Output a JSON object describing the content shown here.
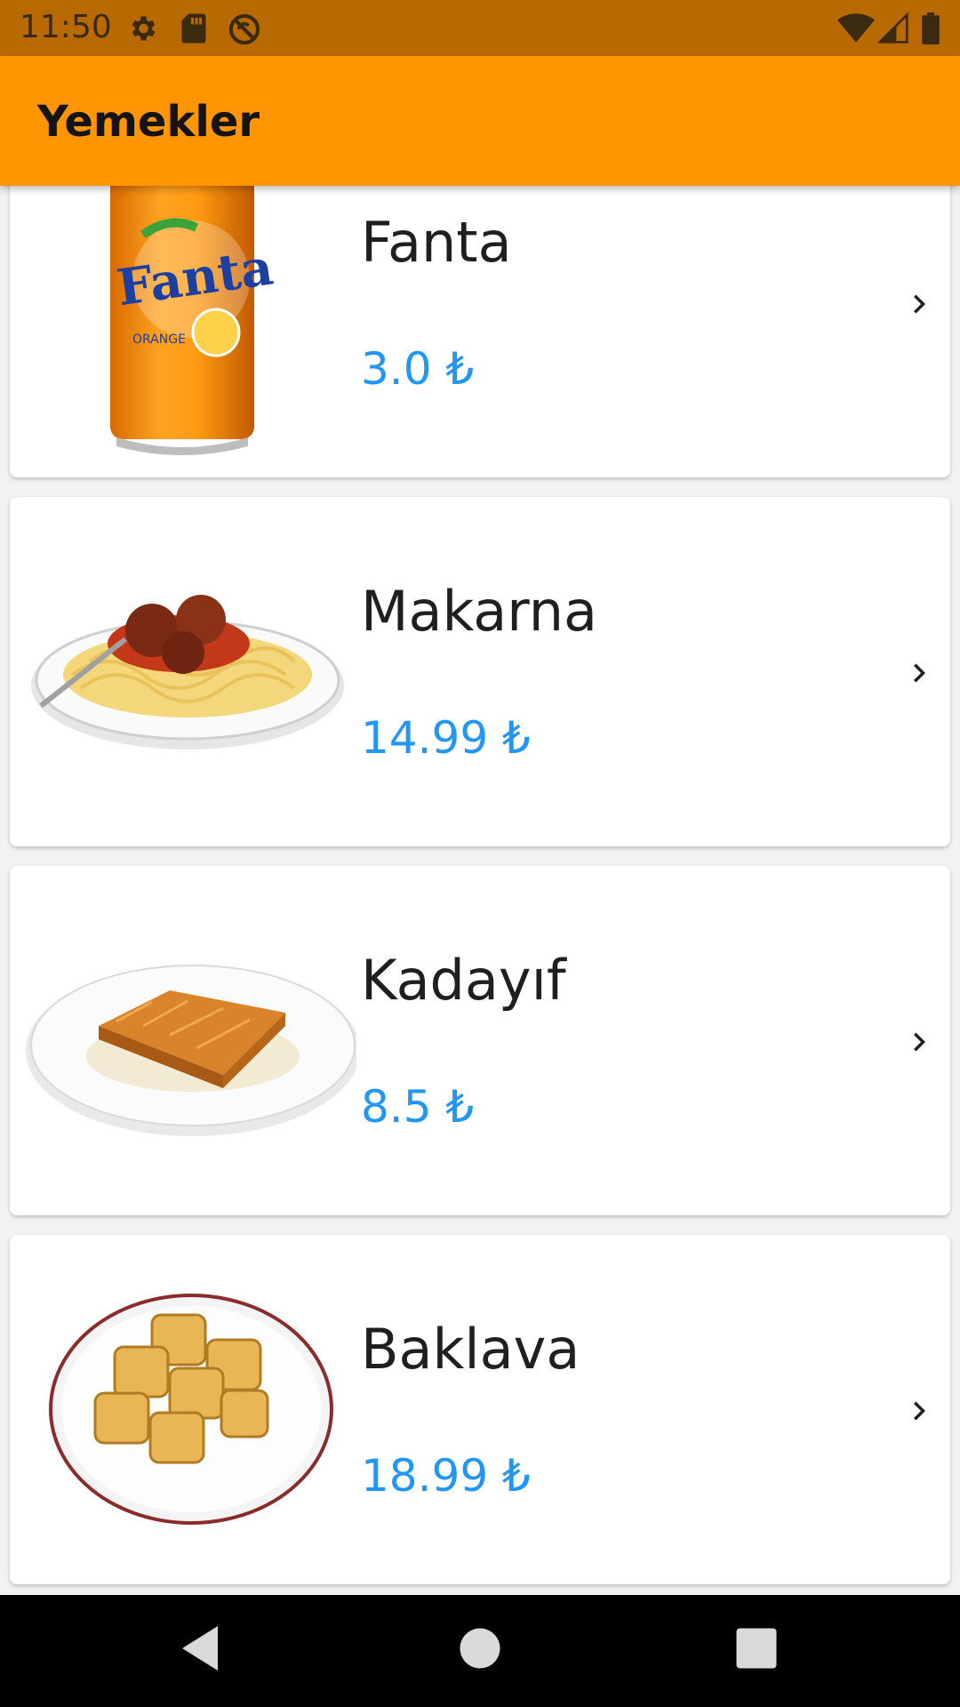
{
  "status_bar": {
    "time": "11:50",
    "left_icons": [
      "gear-icon",
      "sd-card-icon",
      "no-disturb-icon"
    ],
    "right_icons": [
      "wifi-icon",
      "signal-icon",
      "battery-icon"
    ]
  },
  "app_bar": {
    "title": "Yemekler",
    "color": "#ff9500"
  },
  "items": [
    {
      "name": "Fanta",
      "price": "3.0 ₺",
      "image": "fanta-can-image"
    },
    {
      "name": "Makarna",
      "price": "14.99 ₺",
      "image": "spaghetti-plate-image"
    },
    {
      "name": "Kadayıf",
      "price": "8.5 ₺",
      "image": "kadayif-plate-image"
    },
    {
      "name": "Baklava",
      "price": "18.99 ₺",
      "image": "baklava-plate-image"
    }
  ],
  "price_color": "#2196f3",
  "nav_bar": {
    "buttons": [
      "back-icon",
      "home-icon",
      "recents-icon"
    ]
  }
}
